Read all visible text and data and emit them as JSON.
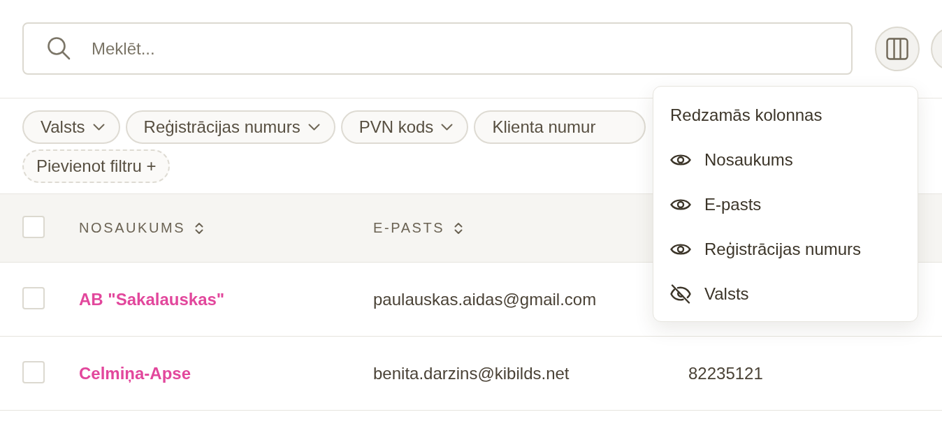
{
  "search": {
    "placeholder": "Meklēt..."
  },
  "toolbar_buttons": [
    {
      "kind": "columns"
    },
    {
      "kind": "other"
    }
  ],
  "filters": [
    {
      "label": "Valsts",
      "dropdown": true
    },
    {
      "label": "Reģistrācijas numurs",
      "dropdown": true
    },
    {
      "label": "PVN kods",
      "dropdown": true
    },
    {
      "label": "Klienta numur",
      "dropdown": false
    }
  ],
  "add_filter": {
    "label": "Pievienot filtru +"
  },
  "table": {
    "select_all": {
      "checked": false
    },
    "columns": [
      {
        "label": "NOSAUKUMS",
        "sortable": true
      },
      {
        "label": "E-PASTS",
        "sortable": true
      }
    ],
    "rows": [
      {
        "selected": false,
        "name": "AB \"Sakalauskas\"",
        "email": "paulauskas.aidas@gmail.com"
      },
      {
        "selected": false,
        "name": "Celmiņa-Apse",
        "email": "benita.darzins@kibilds.net",
        "column_3": "82235121"
      }
    ]
  },
  "column_menu": {
    "title": "Redzamās kolonnas",
    "items": [
      {
        "label": "Nosaukums",
        "visible": true
      },
      {
        "label": "E-pasts",
        "visible": true
      },
      {
        "label": "Reģistrācijas numurs",
        "visible": true
      },
      {
        "label": "Valsts",
        "visible": false
      }
    ]
  }
}
